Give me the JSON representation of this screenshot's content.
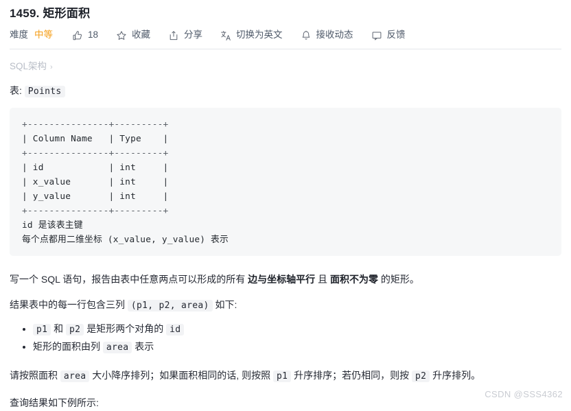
{
  "problem": {
    "title": "1459. 矩形面积"
  },
  "toolbar": {
    "difficulty_label": "难度",
    "difficulty_value": "中等",
    "like_count": "18",
    "favorite_label": "收藏",
    "share_label": "分享",
    "translate_label": "切换为英文",
    "subscribe_label": "接收动态",
    "feedback_label": "反馈",
    "icons": {
      "like": "thumbs-up-icon",
      "favorite": "star-icon",
      "share": "share-box-icon",
      "translate": "translate-icon",
      "subscribe": "bell-icon",
      "feedback": "comment-icon"
    }
  },
  "breadcrumb": {
    "label": "SQL架构",
    "separator": "›"
  },
  "table_caption": {
    "prefix": "表:",
    "name": "Points"
  },
  "code_block": {
    "lines": [
      "+---------------+---------+",
      "| Column Name   | Type    |",
      "+---------------+---------+",
      "| id            | int     |",
      "| x_value       | int     |",
      "| y_value       | int     |",
      "+---------------+---------+"
    ],
    "note_line_1": "id 是该表主键",
    "note_line_2": "每个点都用二维坐标 (x_value, y_value) 表示"
  },
  "content": {
    "paragraph_1": {
      "t1": "写一个 SQL 语句，报告由表中任意两点可以形成的所有 ",
      "b1": "边与坐标轴平行",
      "t2": " 且 ",
      "b2": "面积不为零",
      "t3": " 的矩形。"
    },
    "paragraph_2": {
      "t1": "结果表中的每一行包含三列 ",
      "code": "(p1, p2, area)",
      "t2": " 如下:"
    },
    "bullets": [
      {
        "c1": "p1",
        "t1": " 和 ",
        "c2": "p2",
        "t2": " 是矩形两个对角的 ",
        "c3": "id"
      },
      {
        "t1": "矩形的面积由列 ",
        "c1": "area",
        "t2": " 表示"
      }
    ],
    "paragraph_3": {
      "t1": "请按照面积 ",
      "c1": "area",
      "t2": " 大小降序排列；如果面积相同的话, 则按照 ",
      "c2": "p1",
      "t3": " 升序排序；若仍相同，则按 ",
      "c3": "p2",
      "t4": " 升序排列。"
    },
    "paragraph_4": "查询结果如下例所示:"
  },
  "watermark": "CSDN @SSS4362"
}
